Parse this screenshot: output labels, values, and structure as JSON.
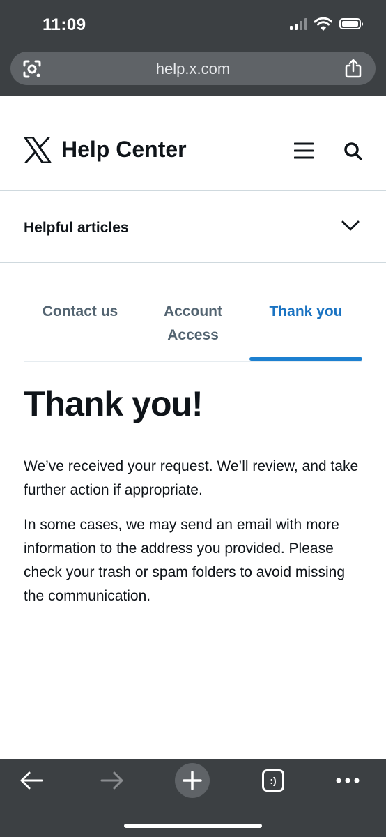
{
  "status_bar": {
    "time": "11:09"
  },
  "browser": {
    "url": "help.x.com",
    "tabs_label": ":)"
  },
  "header": {
    "title": "Help Center"
  },
  "helpful": {
    "label": "Helpful articles"
  },
  "tabs": [
    {
      "label": "Contact us",
      "active": false
    },
    {
      "label": "Account Access",
      "active": false
    },
    {
      "label": "Thank you",
      "active": true
    }
  ],
  "content": {
    "heading": "Thank you!",
    "paragraph_1": "We’ve received your request. We’ll review, and take further action if appropriate.",
    "paragraph_2": "In some cases, we may send an email with more information to the address you provided. Please check your trash or spam folders to avoid missing the communication."
  },
  "colors": {
    "chrome": "#3c4043",
    "accent": "#1d80d0",
    "text": "#0f1419",
    "muted": "#536471"
  }
}
